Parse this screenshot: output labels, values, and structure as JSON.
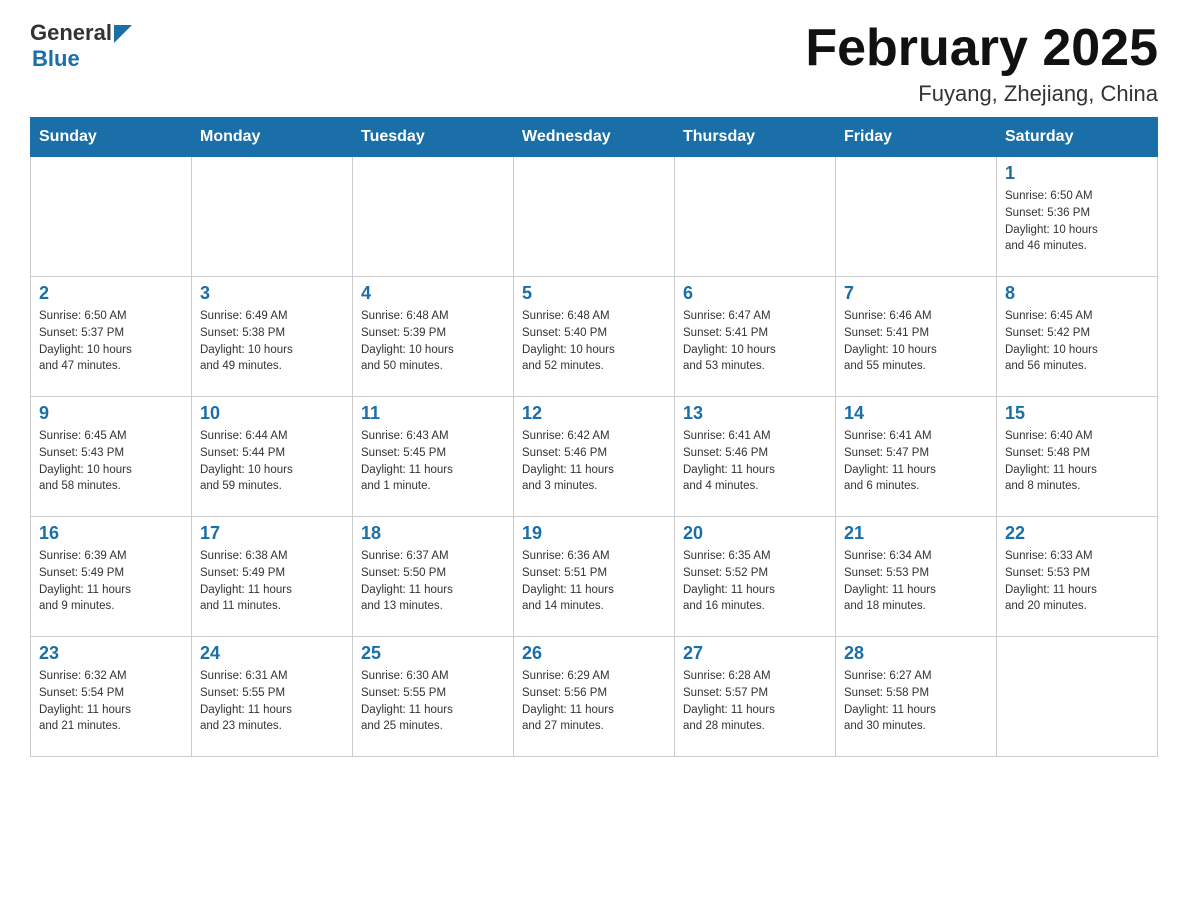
{
  "header": {
    "logo_general": "General",
    "logo_blue": "Blue",
    "title": "February 2025",
    "location": "Fuyang, Zhejiang, China"
  },
  "days_of_week": [
    "Sunday",
    "Monday",
    "Tuesday",
    "Wednesday",
    "Thursday",
    "Friday",
    "Saturday"
  ],
  "weeks": [
    {
      "days": [
        {
          "num": "",
          "info": ""
        },
        {
          "num": "",
          "info": ""
        },
        {
          "num": "",
          "info": ""
        },
        {
          "num": "",
          "info": ""
        },
        {
          "num": "",
          "info": ""
        },
        {
          "num": "",
          "info": ""
        },
        {
          "num": "1",
          "info": "Sunrise: 6:50 AM\nSunset: 5:36 PM\nDaylight: 10 hours\nand 46 minutes."
        }
      ]
    },
    {
      "days": [
        {
          "num": "2",
          "info": "Sunrise: 6:50 AM\nSunset: 5:37 PM\nDaylight: 10 hours\nand 47 minutes."
        },
        {
          "num": "3",
          "info": "Sunrise: 6:49 AM\nSunset: 5:38 PM\nDaylight: 10 hours\nand 49 minutes."
        },
        {
          "num": "4",
          "info": "Sunrise: 6:48 AM\nSunset: 5:39 PM\nDaylight: 10 hours\nand 50 minutes."
        },
        {
          "num": "5",
          "info": "Sunrise: 6:48 AM\nSunset: 5:40 PM\nDaylight: 10 hours\nand 52 minutes."
        },
        {
          "num": "6",
          "info": "Sunrise: 6:47 AM\nSunset: 5:41 PM\nDaylight: 10 hours\nand 53 minutes."
        },
        {
          "num": "7",
          "info": "Sunrise: 6:46 AM\nSunset: 5:41 PM\nDaylight: 10 hours\nand 55 minutes."
        },
        {
          "num": "8",
          "info": "Sunrise: 6:45 AM\nSunset: 5:42 PM\nDaylight: 10 hours\nand 56 minutes."
        }
      ]
    },
    {
      "days": [
        {
          "num": "9",
          "info": "Sunrise: 6:45 AM\nSunset: 5:43 PM\nDaylight: 10 hours\nand 58 minutes."
        },
        {
          "num": "10",
          "info": "Sunrise: 6:44 AM\nSunset: 5:44 PM\nDaylight: 10 hours\nand 59 minutes."
        },
        {
          "num": "11",
          "info": "Sunrise: 6:43 AM\nSunset: 5:45 PM\nDaylight: 11 hours\nand 1 minute."
        },
        {
          "num": "12",
          "info": "Sunrise: 6:42 AM\nSunset: 5:46 PM\nDaylight: 11 hours\nand 3 minutes."
        },
        {
          "num": "13",
          "info": "Sunrise: 6:41 AM\nSunset: 5:46 PM\nDaylight: 11 hours\nand 4 minutes."
        },
        {
          "num": "14",
          "info": "Sunrise: 6:41 AM\nSunset: 5:47 PM\nDaylight: 11 hours\nand 6 minutes."
        },
        {
          "num": "15",
          "info": "Sunrise: 6:40 AM\nSunset: 5:48 PM\nDaylight: 11 hours\nand 8 minutes."
        }
      ]
    },
    {
      "days": [
        {
          "num": "16",
          "info": "Sunrise: 6:39 AM\nSunset: 5:49 PM\nDaylight: 11 hours\nand 9 minutes."
        },
        {
          "num": "17",
          "info": "Sunrise: 6:38 AM\nSunset: 5:49 PM\nDaylight: 11 hours\nand 11 minutes."
        },
        {
          "num": "18",
          "info": "Sunrise: 6:37 AM\nSunset: 5:50 PM\nDaylight: 11 hours\nand 13 minutes."
        },
        {
          "num": "19",
          "info": "Sunrise: 6:36 AM\nSunset: 5:51 PM\nDaylight: 11 hours\nand 14 minutes."
        },
        {
          "num": "20",
          "info": "Sunrise: 6:35 AM\nSunset: 5:52 PM\nDaylight: 11 hours\nand 16 minutes."
        },
        {
          "num": "21",
          "info": "Sunrise: 6:34 AM\nSunset: 5:53 PM\nDaylight: 11 hours\nand 18 minutes."
        },
        {
          "num": "22",
          "info": "Sunrise: 6:33 AM\nSunset: 5:53 PM\nDaylight: 11 hours\nand 20 minutes."
        }
      ]
    },
    {
      "days": [
        {
          "num": "23",
          "info": "Sunrise: 6:32 AM\nSunset: 5:54 PM\nDaylight: 11 hours\nand 21 minutes."
        },
        {
          "num": "24",
          "info": "Sunrise: 6:31 AM\nSunset: 5:55 PM\nDaylight: 11 hours\nand 23 minutes."
        },
        {
          "num": "25",
          "info": "Sunrise: 6:30 AM\nSunset: 5:55 PM\nDaylight: 11 hours\nand 25 minutes."
        },
        {
          "num": "26",
          "info": "Sunrise: 6:29 AM\nSunset: 5:56 PM\nDaylight: 11 hours\nand 27 minutes."
        },
        {
          "num": "27",
          "info": "Sunrise: 6:28 AM\nSunset: 5:57 PM\nDaylight: 11 hours\nand 28 minutes."
        },
        {
          "num": "28",
          "info": "Sunrise: 6:27 AM\nSunset: 5:58 PM\nDaylight: 11 hours\nand 30 minutes."
        },
        {
          "num": "",
          "info": ""
        }
      ]
    }
  ]
}
